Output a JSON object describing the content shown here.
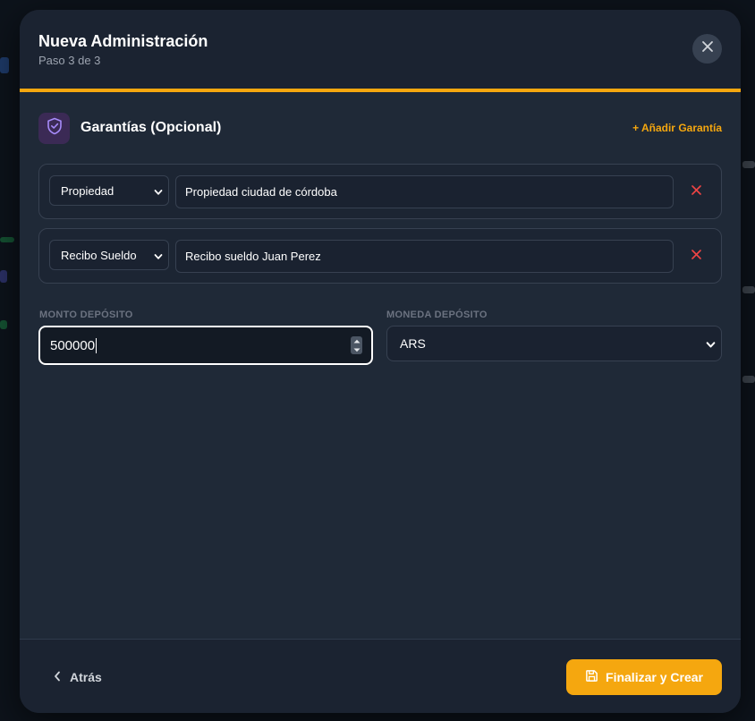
{
  "modal": {
    "title": "Nueva Administración",
    "subtitle": "Paso 3 de 3",
    "progress_percent": 100
  },
  "section": {
    "title": "Garantías (Opcional)",
    "add_label": "+ Añadir Garantía"
  },
  "guarantees": [
    {
      "type": "Propiedad",
      "description": "Propiedad ciudad de córdoba"
    },
    {
      "type": "Recibo Sueldo",
      "description": "Recibo sueldo Juan Perez"
    }
  ],
  "deposit": {
    "amount_label": "MONTO DEPÓSITO",
    "amount_value": "500000",
    "currency_label": "MONEDA DEPÓSITO",
    "currency_value": "ARS"
  },
  "footer": {
    "back_label": "Atrás",
    "finish_label": "Finalizar y Crear"
  },
  "colors": {
    "accent": "#f5a70f",
    "danger": "#ef4444",
    "surface": "#1f2937",
    "icon_purple": "#a78bfa"
  },
  "icons": {
    "close": "close-icon",
    "shield": "shield-check-icon",
    "remove": "close-icon",
    "back": "chevron-left-icon",
    "save": "save-icon"
  }
}
